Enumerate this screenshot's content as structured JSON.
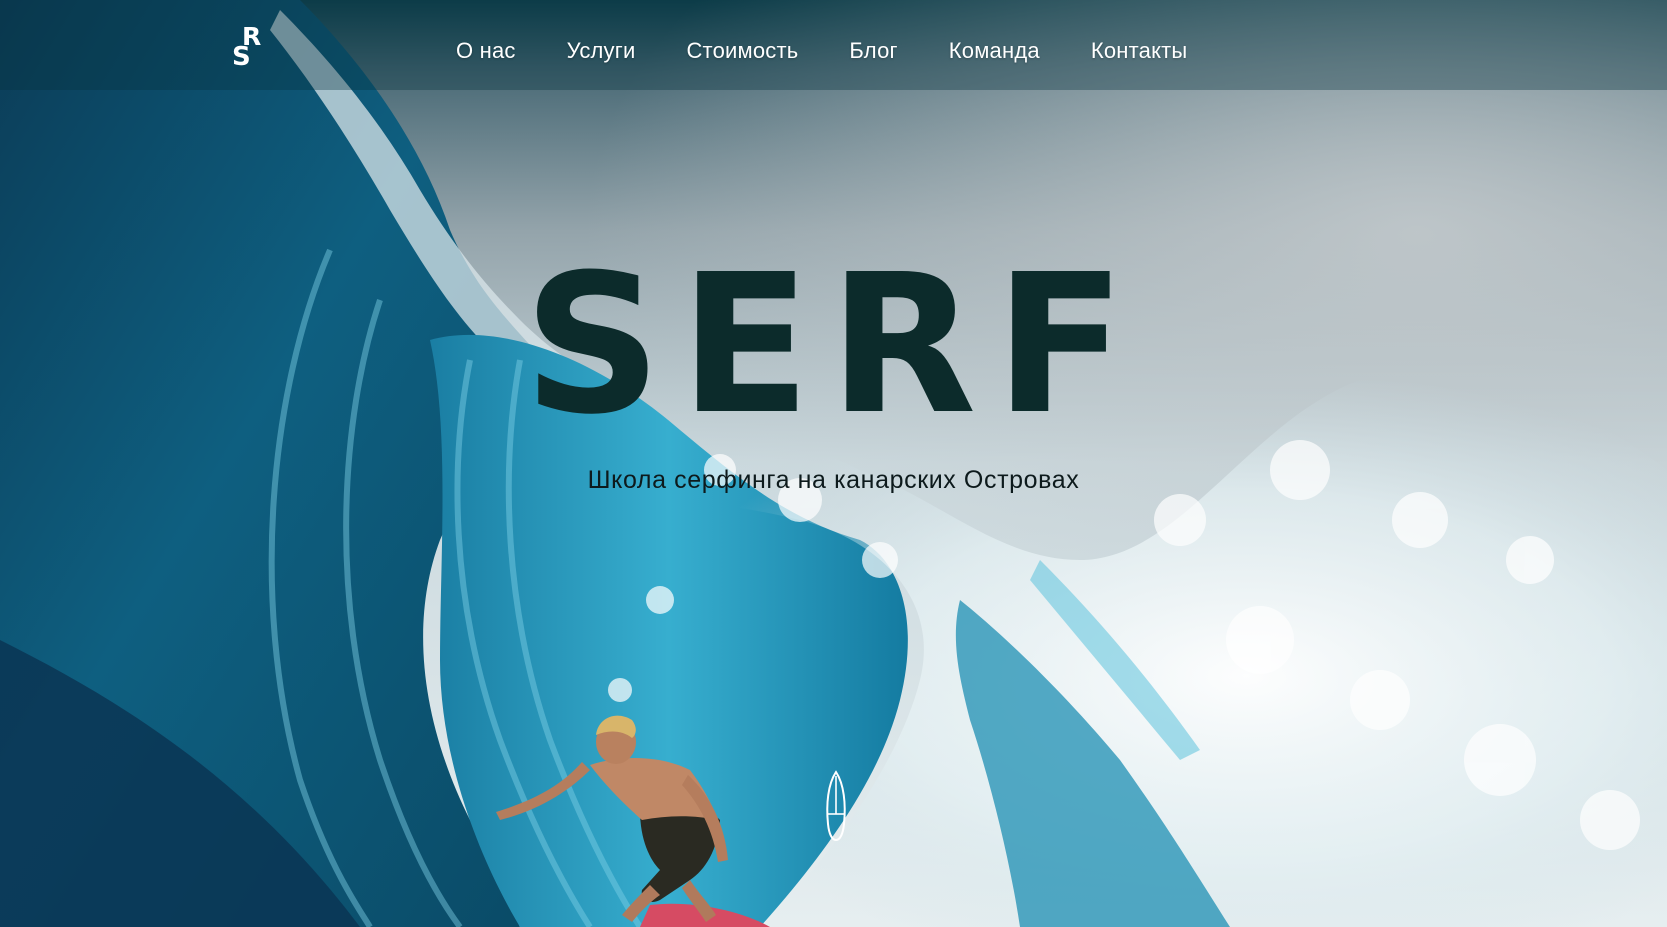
{
  "logo": {
    "letter_top": "R",
    "letter_bottom": "S"
  },
  "nav": {
    "items": [
      {
        "label": "О нас"
      },
      {
        "label": "Услуги"
      },
      {
        "label": "Стоимость"
      },
      {
        "label": "Блог"
      },
      {
        "label": "Команда"
      },
      {
        "label": "Контакты"
      }
    ]
  },
  "hero": {
    "title": "SERF",
    "subtitle": "Школа серфинга на канарских Островах"
  },
  "icons": {
    "logo": "logo-icon",
    "scroll": "surfboard-icon"
  },
  "colors": {
    "title": "#0c2b2b",
    "nav_text": "#ffffff",
    "wave_deep": "#0a4a62",
    "wave_light": "#2aa6c8",
    "foam": "#e9f3f6"
  }
}
